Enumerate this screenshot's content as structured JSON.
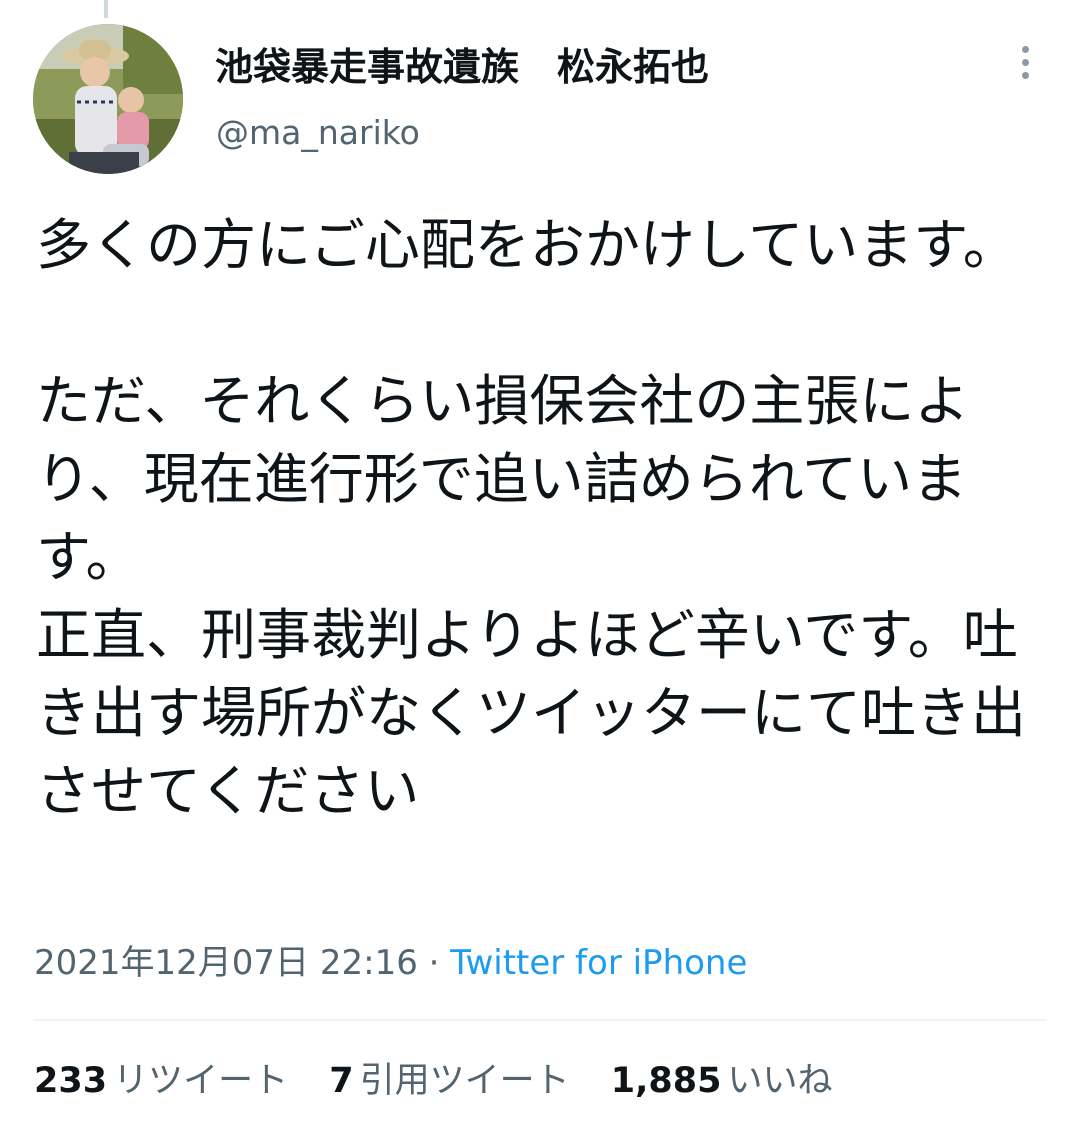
{
  "tweet": {
    "author": {
      "display_name": "池袋暴走事故遺族　松永拓也",
      "handle": "@ma_nariko"
    },
    "text": "多くの方にご心配をおかけしています。\n\nただ、それくらい損保会社の主張により、現在進行形で追い詰められています。\n正直、刑事裁判よりよほど辛いです。吐き出す場所がなくツイッターにて吐き出させてください",
    "timestamp": "2021年12月07日 22:16",
    "separator": "·",
    "source": "Twitter for iPhone",
    "stats": [
      {
        "count": "233",
        "label": "リツイート"
      },
      {
        "count": "7",
        "label": "引用ツイート"
      },
      {
        "count": "1,885",
        "label": "いいね"
      }
    ]
  },
  "icons": {
    "more": "vertical-ellipsis-icon",
    "avatar": "profile-photo"
  },
  "colors": {
    "text_primary": "#0f1419",
    "text_secondary": "#536471",
    "link": "#1d9bf0",
    "divider": "#eff3f4",
    "thread_line": "#cfd9de"
  }
}
